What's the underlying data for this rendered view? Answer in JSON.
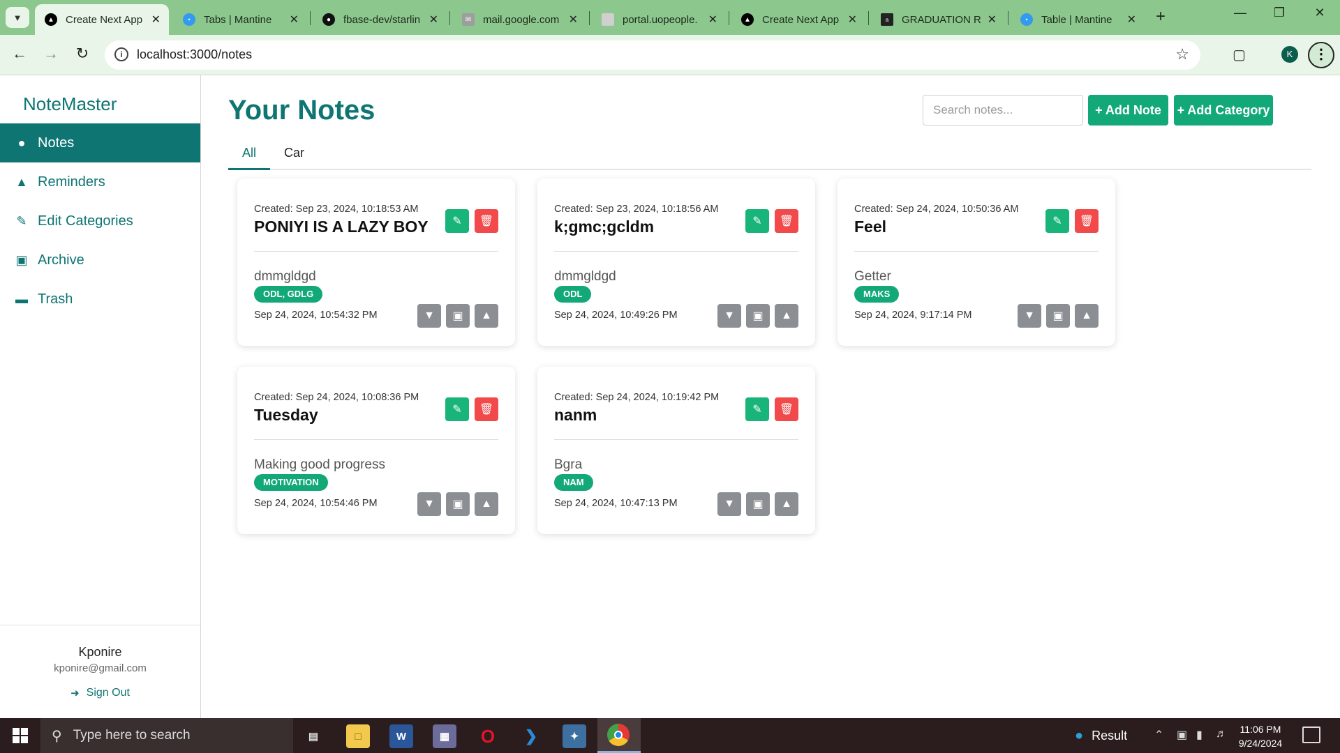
{
  "browser": {
    "tabs": [
      {
        "label": "Create Next App",
        "icon": "nextjs-icon",
        "color": "#000000",
        "active": true
      },
      {
        "label": "Tabs | Mantine",
        "icon": "mantine-icon",
        "color": "#339af0",
        "active": false
      },
      {
        "label": "fbase-dev/starlin",
        "icon": "github-icon",
        "color": "#111111",
        "active": false
      },
      {
        "label": "mail.google.com",
        "icon": "gmail-icon",
        "color": "#9e9e9e",
        "active": false
      },
      {
        "label": "portal.uopeople.",
        "icon": "portal-icon",
        "color": "#cfcfcf",
        "active": false
      },
      {
        "label": "Create Next App",
        "icon": "nextjs-icon",
        "color": "#000000",
        "active": false
      },
      {
        "label": "GRADUATION R",
        "icon": "alx-icon",
        "color": "#222222",
        "active": false
      },
      {
        "label": "Table | Mantine",
        "icon": "mantine-icon",
        "color": "#339af0",
        "active": false
      }
    ],
    "url": "localhost:3000/notes",
    "profile_initial": "K"
  },
  "app": {
    "brand": "NoteMaster",
    "nav": [
      {
        "label": "Notes",
        "icon": "lightbulb-icon",
        "active": true
      },
      {
        "label": "Reminders",
        "icon": "bell-icon",
        "active": false
      },
      {
        "label": "Edit Categories",
        "icon": "edit-icon",
        "active": false
      },
      {
        "label": "Archive",
        "icon": "archive-icon",
        "active": false
      },
      {
        "label": "Trash",
        "icon": "trash-icon",
        "active": false
      }
    ],
    "user": {
      "name": "Kponire",
      "email": "kponire@gmail.com",
      "sign_out": "Sign Out"
    }
  },
  "header": {
    "title": "Your Notes",
    "search_placeholder": "Search notes...",
    "add_note": "+ Add Note",
    "add_category": "+ Add Category"
  },
  "category_tabs": [
    {
      "label": "All",
      "active": true
    },
    {
      "label": "Car",
      "active": false
    }
  ],
  "notes": [
    {
      "created": "Created: Sep 23, 2024, 10:18:53 AM",
      "title": "PONIYI IS A LAZY BOY",
      "body": "dmmgldgd",
      "categories": "ODL, GDLG",
      "date": "Sep 24, 2024, 10:54:32 PM"
    },
    {
      "created": "Created: Sep 23, 2024, 10:18:56 AM",
      "title": "k;gmc;gcldm",
      "body": "dmmgldgd",
      "categories": "ODL",
      "date": "Sep 24, 2024, 10:49:26 PM"
    },
    {
      "created": "Created: Sep 24, 2024, 10:50:36 AM",
      "title": "Feel",
      "body": "Getter",
      "categories": "MAKS",
      "date": "Sep 24, 2024, 9:17:14 PM"
    },
    {
      "created": "Created: Sep 24, 2024, 10:08:36 PM",
      "title": "Tuesday",
      "body": "Making good progress",
      "categories": "MOTIVATION",
      "date": "Sep 24, 2024, 10:54:46 PM"
    },
    {
      "created": "Created: Sep 24, 2024, 10:19:42 PM",
      "title": "nanm",
      "body": "Bgra",
      "categories": "NAM",
      "date": "Sep 24, 2024, 10:47:13 PM"
    }
  ],
  "taskbar": {
    "search_placeholder": "Type here to search",
    "weather": "Result",
    "time": "11:06 PM",
    "date": "9/24/2024"
  },
  "colors": {
    "brand": "#0e7573",
    "button_green": "#13a878",
    "delete_red": "#f24a4a",
    "icon_gray": "#8b8f93",
    "chrome_frame": "#8cc78d"
  }
}
